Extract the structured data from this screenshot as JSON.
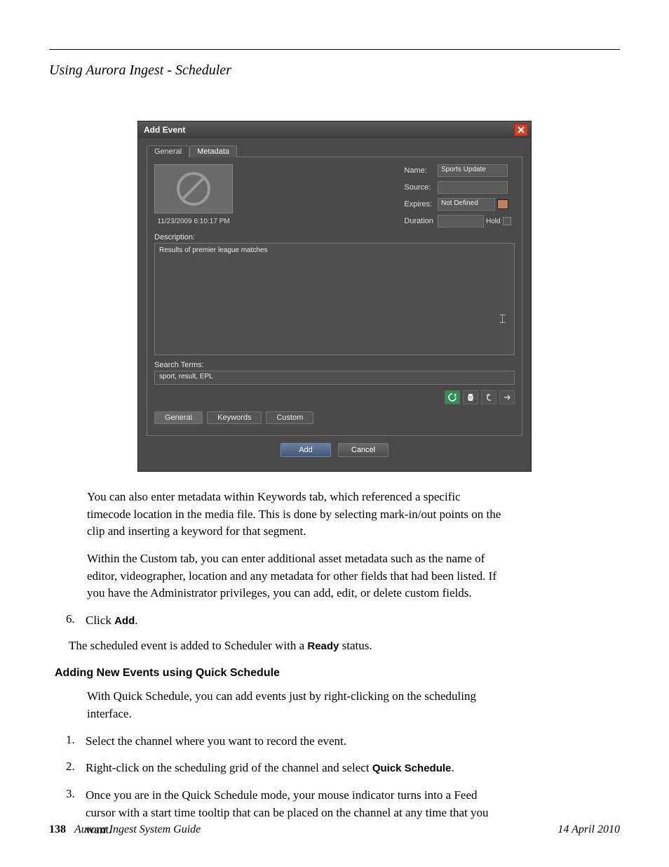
{
  "section_title": "Using Aurora Ingest - Scheduler",
  "dialog": {
    "title": "Add Event",
    "tabs": {
      "general": "General",
      "metadata": "Metadata"
    },
    "timestamp": "11/23/2009 6:10:17 PM",
    "fields": {
      "name_label": "Name:",
      "name_value": "Sports Update",
      "source_label": "Source:",
      "source_value": "",
      "expires_label": "Expires:",
      "expires_value": "Not Defined",
      "duration_label": "Duration",
      "duration_value": "",
      "hold_label": "Hold"
    },
    "description_label": "Description:",
    "description_value": "Results of premier league matches",
    "search_label": "Search Terms:",
    "search_value": "sport, result, EPL",
    "inner_tabs": {
      "general": "General",
      "keywords": "Keywords",
      "custom": "Custom"
    },
    "add_button": "Add",
    "cancel_button": "Cancel"
  },
  "body": {
    "p1": "You can also enter metadata within Keywords tab, which referenced a specific timecode location in the media file. This is done by selecting mark-in/out points on the clip and inserting a keyword for that segment.",
    "p2": "Within the Custom tab, you can enter additional asset metadata such as the name of editor, videographer, location and any metadata for other fields that had been listed. If you have the Administrator privileges, you can add, edit, or delete custom fields.",
    "step6_num": "6.",
    "step6_txt_a": "Click ",
    "step6_txt_b": "Add",
    "step6_txt_c": ".",
    "after": "The scheduled event is added to Scheduler with a ",
    "after_b": "Ready",
    "after_c": " status.",
    "sub": "Adding New Events using Quick Schedule",
    "p3": "With Quick Schedule, you can add events just by right-clicking on the scheduling interface.",
    "s1_num": "1.",
    "s1": "Select the channel where you want to record the event.",
    "s2_num": "2.",
    "s2_a": "Right-click on the scheduling grid of the channel and select ",
    "s2_b": "Quick Schedule",
    "s2_c": ".",
    "s3_num": "3.",
    "s3": "Once you are in the Quick Schedule mode, your mouse indicator turns into a Feed cursor with a start time tooltip that can be placed on the channel at any time that you want."
  },
  "footer": {
    "page": "138",
    "title": "Aurora Ingest System Guide",
    "date": "14 April 2010"
  }
}
